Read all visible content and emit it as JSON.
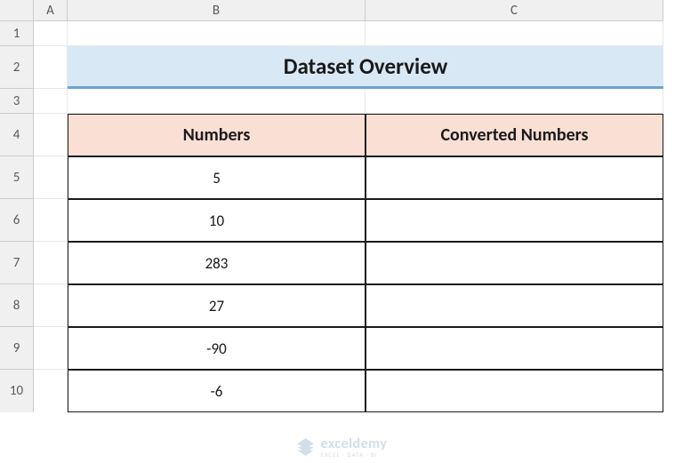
{
  "columns": {
    "A": "A",
    "B": "B",
    "C": "C"
  },
  "rows": {
    "r1": "1",
    "r2": "2",
    "r3": "3",
    "r4": "4",
    "r5": "5",
    "r6": "6",
    "r7": "7",
    "r8": "8",
    "r9": "9",
    "r10": "10"
  },
  "title": "Dataset Overview",
  "headers": {
    "numbers": "Numbers",
    "converted": "Converted Numbers"
  },
  "data": {
    "r5": "5",
    "r6": "10",
    "r7": "283",
    "r8": "27",
    "r9": "-90",
    "r10": "-6"
  },
  "watermark": {
    "name": "exceldemy",
    "sub": "EXCEL · DATA · BI"
  }
}
